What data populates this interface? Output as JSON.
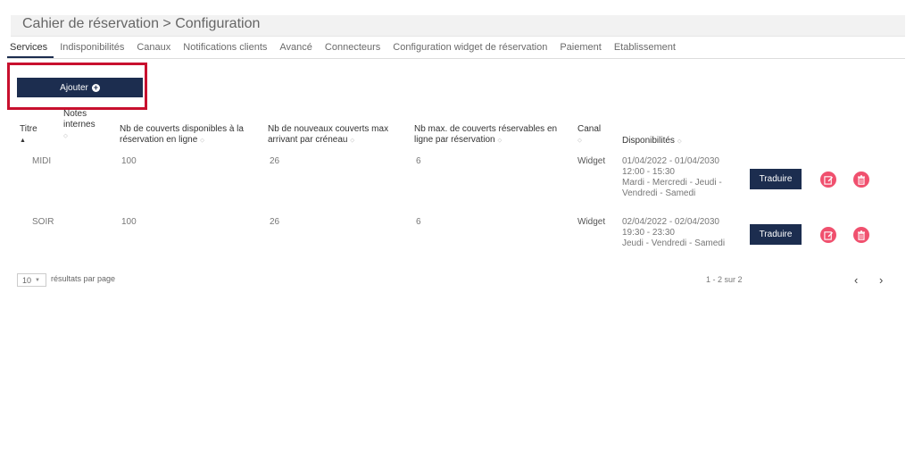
{
  "header": {
    "title": "Cahier de réservation > Configuration"
  },
  "tabs": [
    {
      "label": "Services",
      "active": true
    },
    {
      "label": "Indisponibilités"
    },
    {
      "label": "Canaux"
    },
    {
      "label": "Notifications clients"
    },
    {
      "label": "Avancé"
    },
    {
      "label": "Connecteurs"
    },
    {
      "label": "Configuration widget de réservation"
    },
    {
      "label": "Paiement"
    },
    {
      "label": "Etablissement"
    }
  ],
  "toolbar": {
    "add_label": "Ajouter",
    "add_icon": "plus-circle-icon"
  },
  "table": {
    "headers": {
      "title": "Titre",
      "notes": "Notes internes",
      "covers_online": "Nb de couverts disponibles à la réservation en ligne",
      "new_covers": "Nb de nouveaux couverts max arrivant par créneau",
      "max_covers": "Nb max. de couverts réservables en ligne par réservation",
      "channel": "Canal",
      "availability": "Disponibilités"
    },
    "rows": [
      {
        "title": "MIDI",
        "notes": "",
        "covers_online": "100",
        "new_covers": "26",
        "max_covers": "6",
        "channel": "Widget",
        "dates": "01/04/2022 - 01/04/2030",
        "hours": "12:00 - 15:30",
        "days": "Mardi - Mercredi - Jeudi - Vendredi - Samedi",
        "translate_label": "Traduire"
      },
      {
        "title": "SOIR",
        "notes": "",
        "covers_online": "100",
        "new_covers": "26",
        "max_covers": "6",
        "channel": "Widget",
        "dates": "02/04/2022 - 02/04/2030",
        "hours": "19:30 - 23:30",
        "days": "Jeudi - Vendredi - Samedi",
        "translate_label": "Traduire"
      }
    ]
  },
  "footer": {
    "per_page_value": "10",
    "per_page_label": "résultats par page",
    "pager_info": "1 - 2 sur 2",
    "prev": "‹",
    "next": "›"
  },
  "colors": {
    "primary": "#1c2d4f",
    "danger": "#f0506e",
    "highlight": "#c8102e"
  }
}
